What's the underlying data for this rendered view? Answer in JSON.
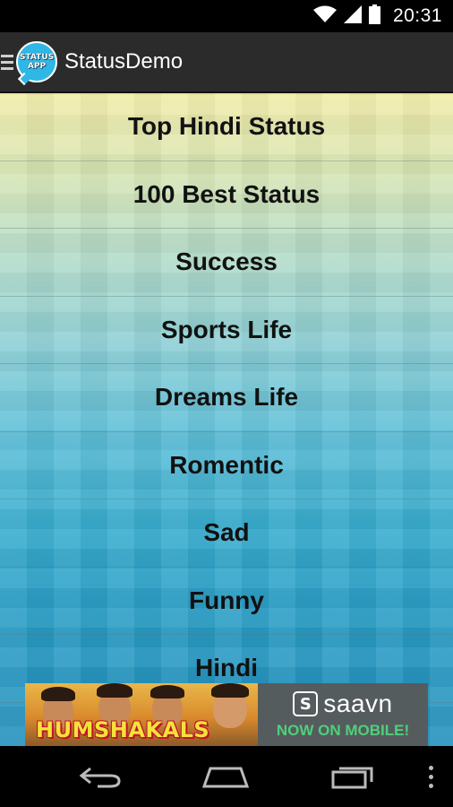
{
  "status_bar": {
    "time": "20:31",
    "icons": [
      "wifi-icon",
      "signal-icon",
      "battery-icon"
    ]
  },
  "action_bar": {
    "title": "StatusDemo",
    "logo_line1": "STATUS",
    "logo_line2": "APP",
    "icons": [
      "drawer-icon",
      "app-logo-icon"
    ]
  },
  "menu": {
    "items": [
      {
        "label": "Top Hindi Status"
      },
      {
        "label": "100 Best Status"
      },
      {
        "label": "Success"
      },
      {
        "label": "Sports Life"
      },
      {
        "label": "Dreams Life"
      },
      {
        "label": "Romentic"
      },
      {
        "label": "Sad"
      },
      {
        "label": "Funny"
      },
      {
        "label": "Hindi"
      }
    ]
  },
  "ad": {
    "brand": "HUMSHAKALS",
    "sponsor": "saavn",
    "tagline": "NOW ON MOBILE!",
    "colors": {
      "tagline": "#4fd07a",
      "brand": "#f5e23a"
    }
  },
  "nav_bar": {
    "icons": [
      "back-icon",
      "home-icon",
      "recent-apps-icon",
      "overflow-menu-icon"
    ]
  },
  "colors": {
    "action_bar": "#2b2b2b",
    "gradient_top": "#f2eca8",
    "gradient_bottom": "#2591bd"
  }
}
